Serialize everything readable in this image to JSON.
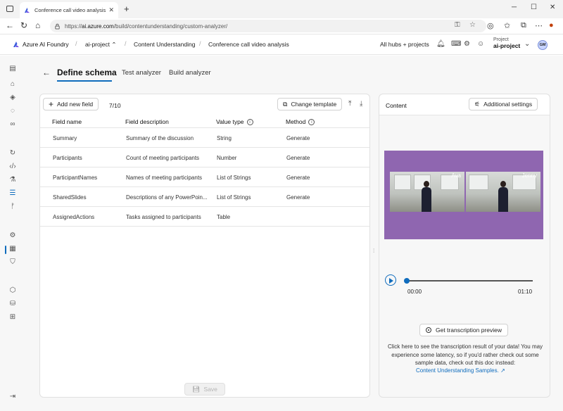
{
  "browser": {
    "tab_title": "Conference call video analysis - A",
    "url_host": "ai.azure.com",
    "url_prefix": "https://",
    "url_path": "/build/contentunderstanding/custom-analyzer/"
  },
  "header": {
    "brand": "Azure AI Foundry",
    "hub": "ai-project",
    "section": "Content Understanding",
    "page": "Conference call video analysis",
    "all_hubs": "All hubs + projects",
    "project_label": "Project",
    "project_name": "ai-project",
    "avatar_initials": "GM"
  },
  "tabs": {
    "define": "Define schema",
    "test": "Test analyzer",
    "build": "Build analyzer"
  },
  "schema": {
    "add_field": "Add new field",
    "count": "7/10",
    "change_template": "Change template",
    "columns": {
      "name": "Field name",
      "description": "Field description",
      "value_type": "Value type",
      "method": "Method"
    },
    "rows": [
      {
        "name": "Summary",
        "description": "Summary of the discussion",
        "type": "String",
        "method": "Generate"
      },
      {
        "name": "Participants",
        "description": "Count of meeting participants",
        "type": "Number",
        "method": "Generate"
      },
      {
        "name": "ParticipantNames",
        "description": "Names of meeting participants",
        "type": "List of Strings",
        "method": "Generate"
      },
      {
        "name": "SharedSlides",
        "description": "Descriptions of any PowerPoin...",
        "type": "List of Strings",
        "method": "Generate"
      },
      {
        "name": "AssignedActions",
        "description": "Tasks assigned to participants",
        "type": "Table",
        "method": ""
      }
    ],
    "save": "Save"
  },
  "content": {
    "title": "Content",
    "settings": "Additional settings",
    "speaker_left": "Ava",
    "speaker_right": "Jenny",
    "time_current": "00:00",
    "time_total": "01:10",
    "progress": 0,
    "transcription_button": "Get transcription preview",
    "help": "Click here to see the transcription result of your data! You may experience some latency, so if you'd rather check out some sample data, check out this doc instead:",
    "help_link": "Content Understanding Samples.",
    "video_bg": "#8f66b0"
  },
  "colors": {
    "accent": "#0f6cbd"
  }
}
